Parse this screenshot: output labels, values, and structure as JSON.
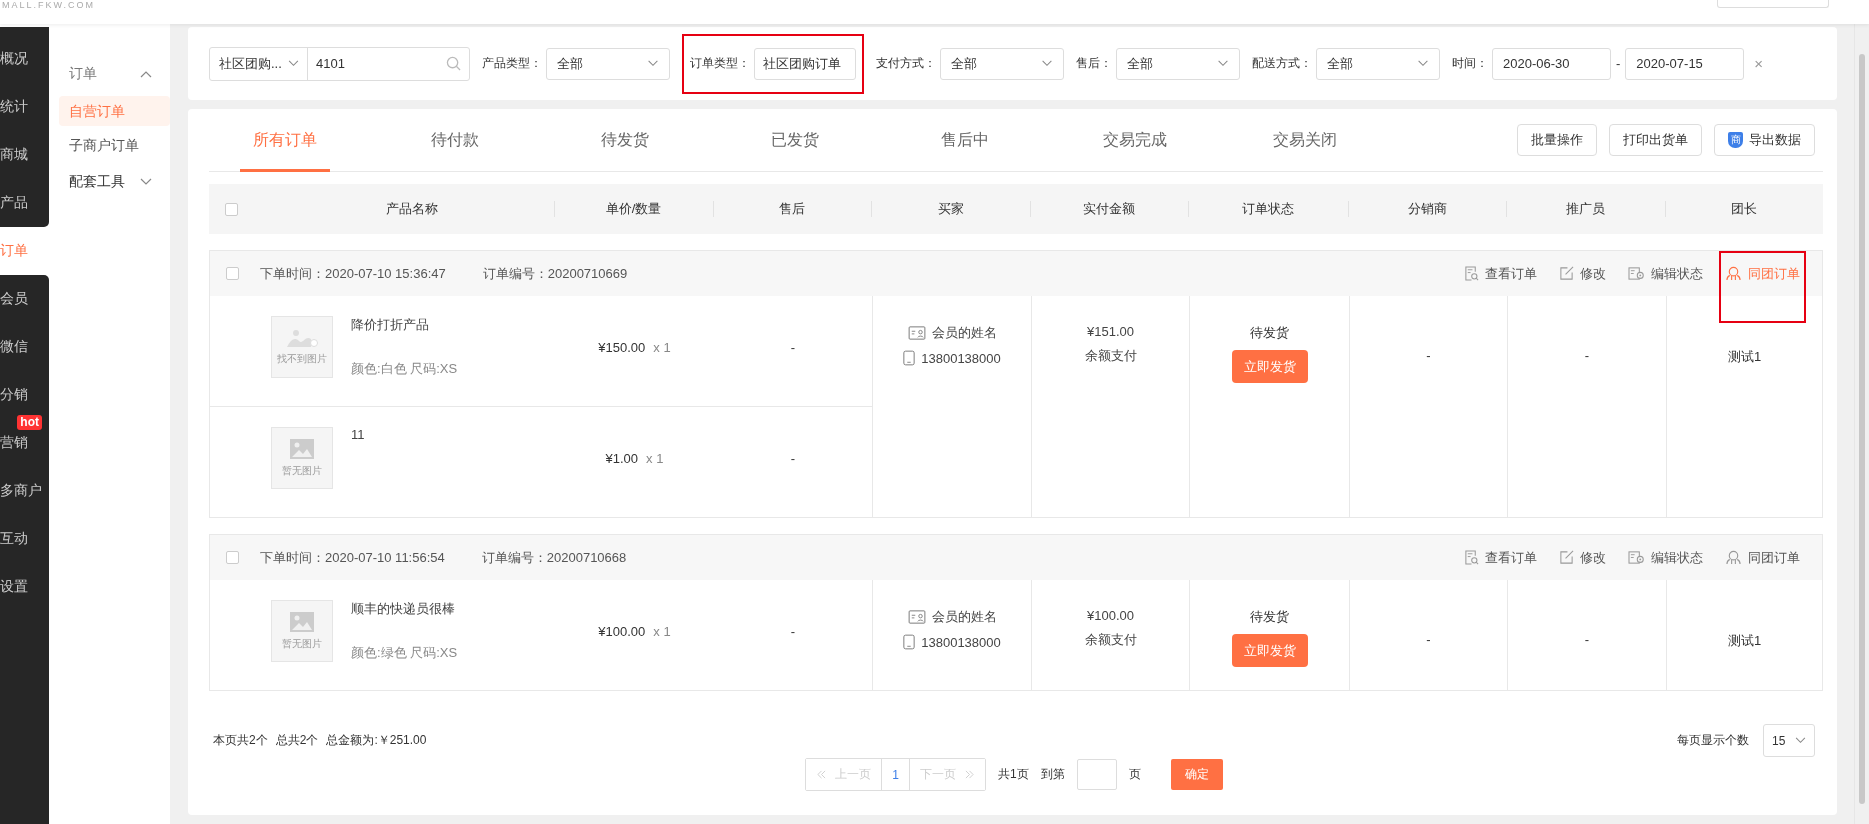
{
  "header": {
    "logo": "MALL.FKW.COM"
  },
  "sidebar": {
    "items": [
      {
        "label": "概况",
        "selected": false
      },
      {
        "label": "统计",
        "selected": false
      },
      {
        "label": "商城",
        "selected": false
      },
      {
        "label": "产品",
        "selected": false
      },
      {
        "label": "订单",
        "selected": true
      },
      {
        "label": "会员",
        "selected": false
      },
      {
        "label": "微信",
        "selected": false
      },
      {
        "label": "分销",
        "selected": false
      },
      {
        "label": "营销",
        "selected": false,
        "badge": "hot"
      },
      {
        "label": "多商户",
        "selected": false
      },
      {
        "label": "互动",
        "selected": false
      },
      {
        "label": "设置",
        "selected": false
      }
    ]
  },
  "submenu": {
    "title": "订单",
    "expanded": true,
    "items": [
      {
        "label": "自营订单",
        "selected": true
      },
      {
        "label": "子商户订单",
        "selected": false
      }
    ],
    "tools": {
      "label": "配套工具",
      "expanded": false
    }
  },
  "filters": {
    "search": {
      "scope": "社区团购...",
      "value": "4101"
    },
    "selects": [
      {
        "label": "产品类型：",
        "value": "全部",
        "highlighted": false
      },
      {
        "label": "订单类型：",
        "value": "社区团购订单",
        "highlighted": true
      },
      {
        "label": "支付方式：",
        "value": "全部",
        "highlighted": false
      },
      {
        "label": "售后：",
        "value": "全部",
        "highlighted": false
      },
      {
        "label": "配送方式：",
        "value": "全部",
        "highlighted": false
      }
    ],
    "date": {
      "label": "时间：",
      "from": "2020-06-30",
      "separator": "-",
      "to": "2020-07-15",
      "clear": "×"
    }
  },
  "tabs": [
    {
      "label": "所有订单",
      "selected": true
    },
    {
      "label": "待付款",
      "selected": false
    },
    {
      "label": "待发货",
      "selected": false
    },
    {
      "label": "已发货",
      "selected": false
    },
    {
      "label": "售后中",
      "selected": false
    },
    {
      "label": "交易完成",
      "selected": false
    },
    {
      "label": "交易关闭",
      "selected": false
    }
  ],
  "toolbar": [
    {
      "label": "批量操作",
      "kind": "plain"
    },
    {
      "label": "打印出货单",
      "kind": "plain"
    },
    {
      "label": "导出数据",
      "kind": "icon",
      "icon_text": "商"
    }
  ],
  "table": {
    "select_all": false,
    "columns": [
      "产品名称",
      "单价/数量",
      "售后",
      "买家",
      "实付金额",
      "订单状态",
      "分销商",
      "推广员",
      "团长"
    ]
  },
  "orders": [
    {
      "checked": false,
      "time": "下单时间：2020-07-10 15:36:47",
      "number": "订单编号：20200710669",
      "actions": [
        {
          "label": "查看订单",
          "kind": "view",
          "highlighted": false
        },
        {
          "label": "修改",
          "kind": "edit",
          "highlighted": false
        },
        {
          "label": "编辑状态",
          "kind": "status",
          "highlighted": false
        },
        {
          "label": "同团订单",
          "kind": "group",
          "highlighted": true
        }
      ],
      "items": [
        {
          "image": {
            "kind": "broken",
            "caption": "找不到图片"
          },
          "name": "降价打折产品",
          "spec": "颜色:白色 尺码:XS",
          "price": "¥150.00",
          "qty": "x 1",
          "after_sale": "-"
        },
        {
          "image": {
            "kind": "empty",
            "caption": "暂无图片"
          },
          "name": "11",
          "price": "¥1.00",
          "qty": "x 1",
          "after_sale": "-"
        }
      ],
      "buyer": {
        "name": "会员的姓名",
        "phone": "13800138000"
      },
      "paid": {
        "amount": "¥151.00",
        "method": "余额支付"
      },
      "status": "待发货",
      "ship_button": "立即发货",
      "distributor": "-",
      "promoter": "-",
      "leader": "测试1"
    },
    {
      "checked": false,
      "time": "下单时间：2020-07-10 11:56:54",
      "number": "订单编号：20200710668",
      "actions": [
        {
          "label": "查看订单",
          "kind": "view",
          "highlighted": false
        },
        {
          "label": "修改",
          "kind": "edit",
          "highlighted": false
        },
        {
          "label": "编辑状态",
          "kind": "status",
          "highlighted": false
        },
        {
          "label": "同团订单",
          "kind": "group",
          "highlighted": false
        }
      ],
      "items": [
        {
          "image": {
            "kind": "empty",
            "caption": "暂无图片"
          },
          "name": "顺丰的快递员很棒",
          "spec": "颜色:绿色 尺码:XS",
          "price": "¥100.00",
          "qty": "x 1",
          "after_sale": "-"
        }
      ],
      "buyer": {
        "name": "会员的姓名",
        "phone": "13800138000"
      },
      "paid": {
        "amount": "¥100.00",
        "method": "余额支付"
      },
      "status": "待发货",
      "ship_button": "立即发货",
      "distributor": "-",
      "promoter": "-",
      "leader": "测试1"
    }
  ],
  "footer": {
    "summary": [
      "本页共2个",
      "总共2个",
      "总金额为:￥251.00"
    ],
    "page_size": {
      "label": "每页显示个数",
      "value": "15"
    },
    "pagination": {
      "prev": {
        "label": "上一页",
        "disabled": true
      },
      "pages": [
        {
          "label": "1",
          "selected": true
        }
      ],
      "next": {
        "label": "下一页",
        "disabled": true
      },
      "total": "共1页",
      "goto": "到第",
      "unit": "页",
      "confirm": "确定"
    }
  }
}
